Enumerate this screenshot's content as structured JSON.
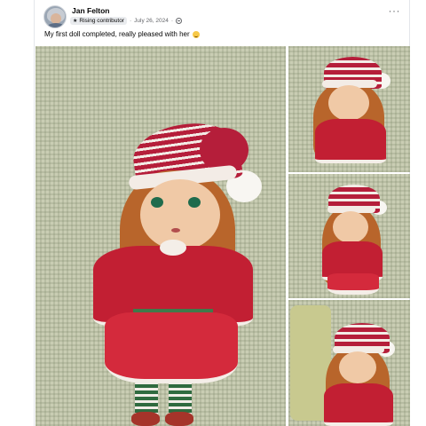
{
  "post": {
    "author": "Jan Felton",
    "badge": "Rising contributor",
    "date": "July 26, 2024",
    "separator": "·",
    "text": "My first doll completed, really pleased with her",
    "more_label": "···"
  },
  "icons": {
    "avatar": "profile-photo",
    "badge_icon": "star-icon",
    "privacy": "globe-icon",
    "emoji": "smiling-face-emoji"
  },
  "colors": {
    "accent_red": "#c21f33",
    "text_secondary": "#65676b"
  }
}
